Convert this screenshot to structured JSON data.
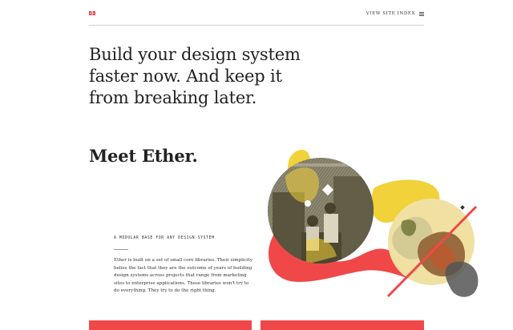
{
  "header": {
    "logo_text": "",
    "site_index_label": "VIEW SITE INDEX"
  },
  "hero": {
    "headline_lines": [
      "Build your design system",
      "faster now. And keep it",
      "from breaking later."
    ],
    "meet": "Meet Ether."
  },
  "intro": {
    "eyebrow": "A MODULAR BASE FOR ANY DESIGN SYSTEM",
    "body": "Ether is built on a set of small core libraries. Their simplicity belies the fact that they are the outcome of years of building design systems across projects that range from marketing sites to enterprise applications. These libraries won't try to do everything. They try to do the right thing."
  },
  "colors": {
    "accent_red": "#f04848",
    "accent_yellow": "#f2d23a",
    "text": "#222222",
    "rule": "#d4d4d4"
  },
  "icons": {
    "logo": "ether-logo-icon",
    "menu": "hamburger-icon"
  }
}
